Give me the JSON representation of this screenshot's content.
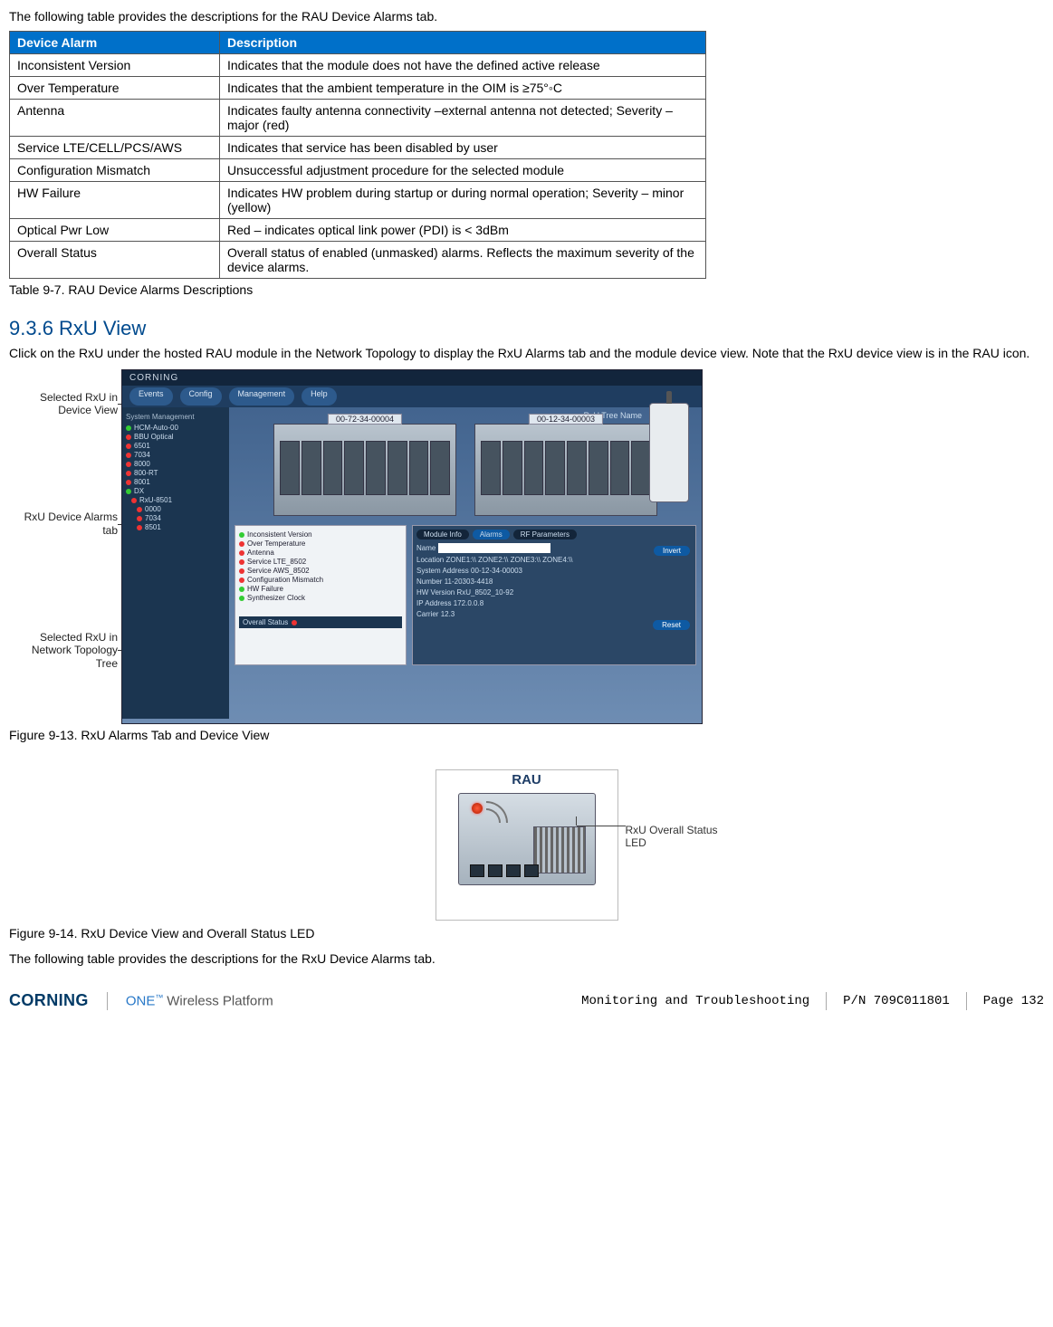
{
  "intro_text": "The following table provides the descriptions for the RAU Device Alarms tab.",
  "table": {
    "headers": [
      "Device Alarm",
      "Description"
    ],
    "rows": [
      [
        "Inconsistent Version",
        "Indicates that the module does not have the defined active release"
      ],
      [
        "Over Temperature",
        "Indicates that the ambient temperature in the OIM is ≥75°◦C"
      ],
      [
        "Antenna",
        "Indicates faulty antenna connectivity –external antenna not detected; Severity – major (red)"
      ],
      [
        "Service LTE/CELL/PCS/AWS",
        "Indicates that service has been disabled by user"
      ],
      [
        "Configuration Mismatch",
        "Unsuccessful adjustment procedure for the selected module"
      ],
      [
        "HW Failure",
        "Indicates HW problem during startup or during normal operation; Severity – minor (yellow)"
      ],
      [
        "Optical Pwr Low",
        "Red – indicates optical link power (PDI) is < 3dBm"
      ],
      [
        "Overall Status",
        "Overall status of enabled (unmasked) alarms. Reflects the maximum severity of the device alarms."
      ]
    ]
  },
  "table_caption": "Table 9-7. RAU Device Alarms Descriptions",
  "section_heading": "9.3.6 RxU View",
  "section_para": "Click on the RxU under the hosted RAU module in the Network Topology to display the RxU Alarms tab and the module device view. Note that the RxU device view is in the RAU icon.",
  "fig1": {
    "callouts": {
      "a": "Selected RxU in Device View",
      "b": "RxU Device Alarms tab",
      "c": "Selected RxU in Network Topology Tree"
    },
    "topbar_brand": "CORNING",
    "menu_tabs": [
      "Events",
      "Config",
      "Management",
      "Help"
    ],
    "side_heading": "System Management",
    "side_nodes": [
      {
        "led": "g",
        "label": "HCM-Auto-00"
      },
      {
        "led": "r",
        "label": "BBU Optical"
      },
      {
        "led": "r",
        "label": "6501"
      },
      {
        "led": "r",
        "label": "7034"
      },
      {
        "led": "r",
        "label": "8000"
      },
      {
        "led": "r",
        "label": "800-RT"
      },
      {
        "led": "r",
        "label": "8001"
      },
      {
        "led": "g",
        "label": "DX"
      },
      {
        "led": "r",
        "label": "RxU-8501"
      },
      {
        "led": "r",
        "label": "0000"
      },
      {
        "led": "r",
        "label": "7034"
      },
      {
        "led": "r",
        "label": "8501"
      }
    ],
    "rack_labels": [
      "00-72-34-00004",
      "00-12-34-00003"
    ],
    "right_label": "RxU Tree Name",
    "alarm_rows": [
      {
        "led": "g",
        "label": "Inconsistent Version"
      },
      {
        "led": "r",
        "label": "Over Temperature"
      },
      {
        "led": "r",
        "label": "Antenna"
      },
      {
        "led": "r",
        "label": "Service LTE_8502"
      },
      {
        "led": "r",
        "label": "Service AWS_8502"
      },
      {
        "led": "r",
        "label": "Configuration Mismatch"
      },
      {
        "led": "g",
        "label": "HW Failure"
      },
      {
        "led": "g",
        "label": "Synthesizer Clock"
      }
    ],
    "overall_status_label": "Overall Status",
    "info_tabs": [
      "Module Info",
      "Alarms",
      "RF Parameters"
    ],
    "info_fields": {
      "name_label": "Name",
      "location_label": "Location",
      "location_value": "ZONE1:\\\\ ZONE2:\\\\ ZONE3:\\\\ ZONE4:\\\\",
      "sysaddr_label": "System Address",
      "sysaddr_value": "00-12-34-00003",
      "number_label": "Number",
      "number_value": "11-20303-4418",
      "hw_label": "HW Version",
      "hw_value": "RxU_8502_10-92",
      "ip_label": "IP Address",
      "ip_value": "172.0.0.8",
      "carrier_label": "Carrier",
      "carrier_value": "12.3"
    },
    "btn_invert": "Invert",
    "btn_reset": "Reset"
  },
  "fig1_caption": "Figure 9-13. RxU Alarms Tab and Device View",
  "fig2": {
    "title": "RAU",
    "callout": "RxU Overall Status LED"
  },
  "fig2_caption": "Figure 9-14. RxU Device View and Overall Status LED",
  "closing_para": "The following table provides the descriptions for the RxU Device Alarms tab.",
  "footer": {
    "brand": "CORNING",
    "one": "ONE",
    "tm": "™",
    "platform": "Wireless Platform",
    "section": "Monitoring and Troubleshooting",
    "pn": "P/N 709C011801",
    "page": "Page 132"
  }
}
